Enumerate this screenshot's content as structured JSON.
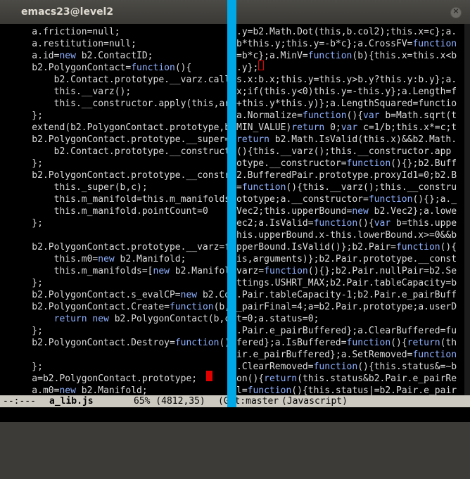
{
  "window": {
    "title": "emacs23@level2"
  },
  "left_lines": [
    "    a.friction=null;",
    "    a.restitution=null;",
    "    a.id=new b2.ContactID;",
    "    b2.PolygonContact=function(){",
    "        b2.Contact.prototype.__varz.call(",
    "        this.__varz();",
    "        this.__constructor.apply(this,arg",
    "    };",
    "    extend(b2.PolygonContact.prototype,b2",
    "    b2.PolygonContact.prototype.__super=ne",
    "        b2.Contact.prototype.__constructor",
    "    };",
    "    b2.PolygonContact.prototype.__construct",
    "        this._super(b,c);",
    "        this.m_manifold=this.m_manifolds[0",
    "        this.m_manifold.pointCount=0",
    "    };",
    "",
    "    b2.PolygonContact.prototype.__varz=fun",
    "        this.m0=new b2.Manifold;",
    "        this.m_manifolds=[new b2.Manifold,",
    "    };",
    "    b2.PolygonContact.s_evalCP=new b2.Con",
    "    b2.PolygonContact.Create=function(b,c",
    "        return new b2.PolygonContact(b,c)",
    "    };",
    "    b2.PolygonContact.Destroy=function(){",
    "",
    "    };",
    "    a=b2.PolygonContact.prototype;",
    "    a.m0=new b2.Manifold;"
  ],
  "right_lines": [
    ".y=b2.Math.Dot(this,b.col2);this.x=c};a.",
    "b*this.y;this.y=-b*c};a.CrossFV=function",
    "=b*c};a.MinV=function(b){this.x=this.x<b",
    ".y};",
    "s.x:b.x;this.y=this.y>b.y?this.y:b.y};a.",
    "x;if(this.y<0)this.y=-this.y};a.Length=f",
    "+this.y*this.y)};a.LengthSquared=functio",
    "a.Normalize=function(){var b=Math.sqrt(t",
    "MIN_VALUE)return 0;var c=1/b;this.x*=c;t",
    "return b2.Math.IsValid(this.x)&&b2.Math.",
    "(){this.__varz();this.__constructor.app",
    "otype.__constructor=function(){};b2.Buff",
    "2.BufferedPair.prototype.proxyId1=0;b2.B",
    "=function(){this.__varz();this.__constru",
    "ototype;a.__constructor=function(){};a._",
    "Vec2;this.upperBound=new b2.Vec2};a.lowe",
    "ec2;a.IsValid=function(){var b=this.uppe",
    "his.upperBound.x-this.lowerBound.x>=0&&b",
    "pperBound.IsValid()};b2.Pair=function(){",
    "is,arguments)};b2.Pair.prototype.__const",
    "varz=function(){};b2.Pair.nullPair=b2.Se",
    "ttings.USHRT_MAX;b2.Pair.tableCapacity=b",
    ".Pair.tableCapacity-1;b2.Pair.e_pairBuff",
    "_pairFinal=4;a=b2.Pair.prototype;a.userD",
    "t=0;a.status=0;",
    ".Pair.e_pairBuffered};a.ClearBuffered=fu",
    "fered};a.IsBuffered=function(){return(th",
    "ir.e_pairBuffered};a.SetRemoved=function",
    ".ClearRemoved=function(){this.status&=~b",
    "on(){return(this.status&b2.Pair.e_pairRe",
    "l=function(){this.status|=b2.Pair.e_pair"
  ],
  "modeline": {
    "status": "--:---",
    "buffer": "a_lib.js",
    "position": "65% (4812,35)",
    "branch": "(Git:master",
    "mode": "(Javascript)"
  },
  "colors": {
    "divider": "#00a8e8",
    "cursor": "#e00000",
    "keyword": "#8fb0ff"
  }
}
